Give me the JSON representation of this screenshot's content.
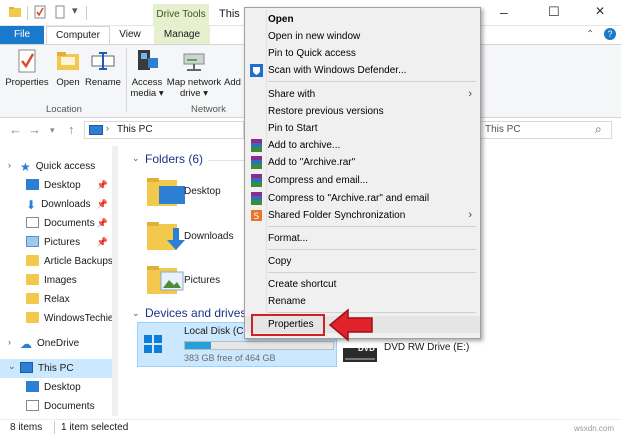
{
  "titlebar": {
    "drive_tools": "Drive Tools",
    "title": "This",
    "minimize": "–",
    "restore": "☐",
    "close": "✕"
  },
  "tabs": {
    "file": "File",
    "computer": "Computer",
    "view": "View",
    "manage": "Manage"
  },
  "ribbon": {
    "properties": "Properties",
    "open": "Open",
    "rename": "Rename",
    "access_media": [
      "Access",
      "media ▾"
    ],
    "map_network_drive": [
      "Map network",
      "drive ▾"
    ],
    "add": "Add",
    "location_label": "Location",
    "network_label": "Network"
  },
  "address": {
    "path": "This PC",
    "search_placeholder": "This PC"
  },
  "nav": {
    "quick_access": "Quick access",
    "desktop": "Desktop",
    "downloads": "Downloads",
    "documents": "Documents",
    "pictures": "Pictures",
    "article_backups": "Article Backups",
    "images": "Images",
    "relax": "Relax",
    "windowstechies": "WindowsTechies",
    "onedrive": "OneDrive",
    "this_pc": "This PC",
    "pc_desktop": "Desktop",
    "pc_documents": "Documents"
  },
  "main": {
    "folders_header": "Folders (6)",
    "folders": [
      "Desktop",
      "Downloads",
      "Pictures"
    ],
    "devices_header": "Devices and drives",
    "local_disk_name": "Local Disk (C:",
    "local_disk_free": "383 GB free of 464 GB",
    "local_disk_used_fraction": 0.175,
    "dvd_name": "DVD RW Drive (E:)",
    "dvd_label": "DVD"
  },
  "status": {
    "items": "8 items",
    "selected": "1 item selected"
  },
  "context_menu": {
    "open": "Open",
    "open_new_window": "Open in new window",
    "pin_quick_access": "Pin to Quick access",
    "scan_defender": "Scan with Windows Defender...",
    "share_with": "Share with",
    "restore_versions": "Restore previous versions",
    "pin_start": "Pin to Start",
    "add_archive": "Add to archive...",
    "add_archive_rar": "Add to \"Archive.rar\"",
    "compress_email": "Compress and email...",
    "compress_rar_email": "Compress to \"Archive.rar\" and email",
    "shared_sync": "Shared Folder Synchronization",
    "format": "Format...",
    "copy": "Copy",
    "create_shortcut": "Create shortcut",
    "rename": "Rename",
    "properties": "Properties"
  },
  "watermark": "wsxdn.com",
  "colors": {
    "accent_blue": "#1979ca",
    "highlight_red": "#d21f26",
    "drive_tools_bg": "#e6f0d0",
    "selection_blue": "#cce8ff"
  }
}
